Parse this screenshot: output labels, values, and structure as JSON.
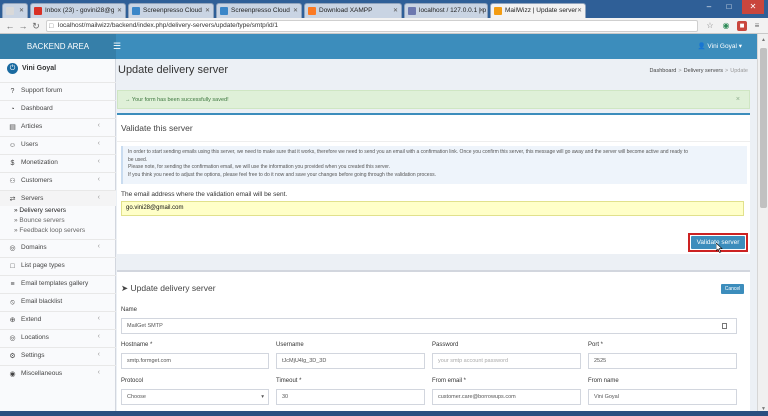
{
  "browser": {
    "tabs": [
      {
        "title": "",
        "color": "#d9d9d9"
      },
      {
        "title": "Inbox (23) - govini28@g",
        "color": "#d93025"
      },
      {
        "title": "Screenpresso Cloud",
        "color": "#3a86c8"
      },
      {
        "title": "Screenpresso Cloud",
        "color": "#3a86c8"
      },
      {
        "title": "Download XAMPP",
        "color": "#fb7a24"
      },
      {
        "title": "localhost / 127.0.0.1 | p",
        "color": "#6c78af"
      },
      {
        "title": "MailWizz | Update server",
        "color": "#f39c12"
      }
    ],
    "url": "localhost/mailwizz/backend/index.php/delivery-servers/update/type/smtp/id/1"
  },
  "header": {
    "brand": "BACKEND AREA",
    "user_name": "Vini Goyal"
  },
  "sidebar": {
    "profile_name": "Vini Goyal",
    "items": [
      {
        "label": "Support forum",
        "icon": "question-icon",
        "chev": false
      },
      {
        "label": "Dashboard",
        "icon": "dashboard-icon",
        "chev": false
      },
      {
        "label": "Articles",
        "icon": "book-icon",
        "chev": true
      },
      {
        "label": "Users",
        "icon": "user-icon",
        "chev": true
      },
      {
        "label": "Monetization",
        "icon": "money-icon",
        "chev": true
      },
      {
        "label": "Customers",
        "icon": "users-icon",
        "chev": true
      },
      {
        "label": "Servers",
        "icon": "transfer-icon",
        "chev": true
      }
    ],
    "server_sub": [
      "Delivery servers",
      "Bounce servers",
      "Feedback loop servers"
    ],
    "items2": [
      {
        "label": "Domains",
        "icon": "globe-icon",
        "chev": true
      },
      {
        "label": "List page types",
        "icon": "file-icon",
        "chev": false
      },
      {
        "label": "Email templates gallery",
        "icon": "text-icon",
        "chev": false
      },
      {
        "label": "Email blacklist",
        "icon": "ban-icon",
        "chev": false
      },
      {
        "label": "Extend",
        "icon": "plus-icon",
        "chev": true
      },
      {
        "label": "Locations",
        "icon": "globe-icon",
        "chev": true
      },
      {
        "label": "Settings",
        "icon": "gear-icon",
        "chev": true
      },
      {
        "label": "Miscellaneous",
        "icon": "bullseye-icon",
        "chev": true
      }
    ]
  },
  "page": {
    "title": "Update delivery server",
    "breadcrumbs": [
      "Dashboard",
      "Delivery servers",
      "Update"
    ],
    "alert": "→ Your form has been successfully saved!"
  },
  "validate_box": {
    "title": "Validate this server",
    "info_lines": [
      "In order to start sending emails using this server, we need to make sure that it works, therefore we need to send you an email with a confirmation link. Once you confirm this server, this message will go away and the server will become active and ready to",
      "be used.",
      "Please note, for sending the confirmation email, we will use the information you provided when you created this server.",
      "If you think you need to adjust the options, please feel free to do it now and save your changes before going through the validation process."
    ],
    "email_label": "The email address where the validation email will be sent.",
    "email_value": "go.vini28@gmail.com",
    "button_label": "Validate server"
  },
  "update_box": {
    "title": "Update delivery server",
    "cancel_label": "Cancel",
    "name_label": "Name",
    "name_value": "MailGet SMTP",
    "hostname_label": "Hostname *",
    "hostname_value": "smtp.formget.com",
    "username_label": "Username",
    "username_value": "tJcMjU4lg_3D_3D",
    "password_label": "Password",
    "password_placeholder": "your smtp account password",
    "port_label": "Port *",
    "port_value": "2525",
    "protocol_label": "Protocol",
    "protocol_value": "Choose",
    "timeout_label": "Timeout *",
    "timeout_value": "30",
    "from_email_label": "From email *",
    "from_email_value": "customer.care@borrowups.com",
    "from_name_label": "From name",
    "from_name_value": "Vini Goyal"
  }
}
